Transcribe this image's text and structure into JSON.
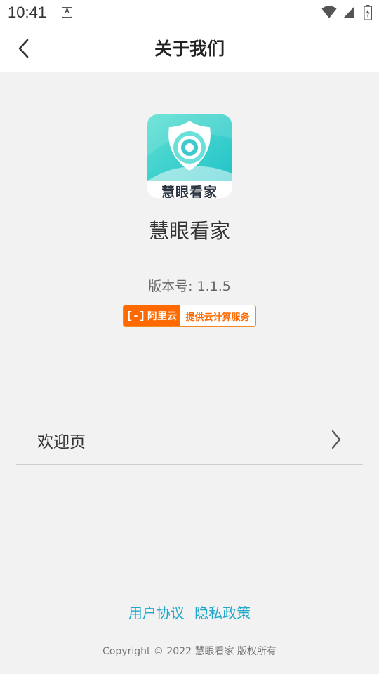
{
  "status_bar": {
    "time": "10:41",
    "notification_icon": "A"
  },
  "header": {
    "title": "关于我们",
    "back_icon": "chevron-left-icon"
  },
  "app": {
    "logo_text": "慧眼看家",
    "name": "慧眼看家",
    "version": "版本号: 1.1.5"
  },
  "badge": {
    "brand": "阿里云",
    "brand_symbol": "[-]",
    "service": "提供云计算服务"
  },
  "menu": {
    "welcome_label": "欢迎页"
  },
  "footer": {
    "user_agreement": "用户协议",
    "privacy_policy": "隐私政策",
    "copyright": "Copyright © 2022 慧眼看家 版权所有"
  },
  "colors": {
    "accent_link": "#1fa8c9",
    "aliyun_orange": "#ff6a00",
    "logo_teal": "#3fd3c9"
  }
}
